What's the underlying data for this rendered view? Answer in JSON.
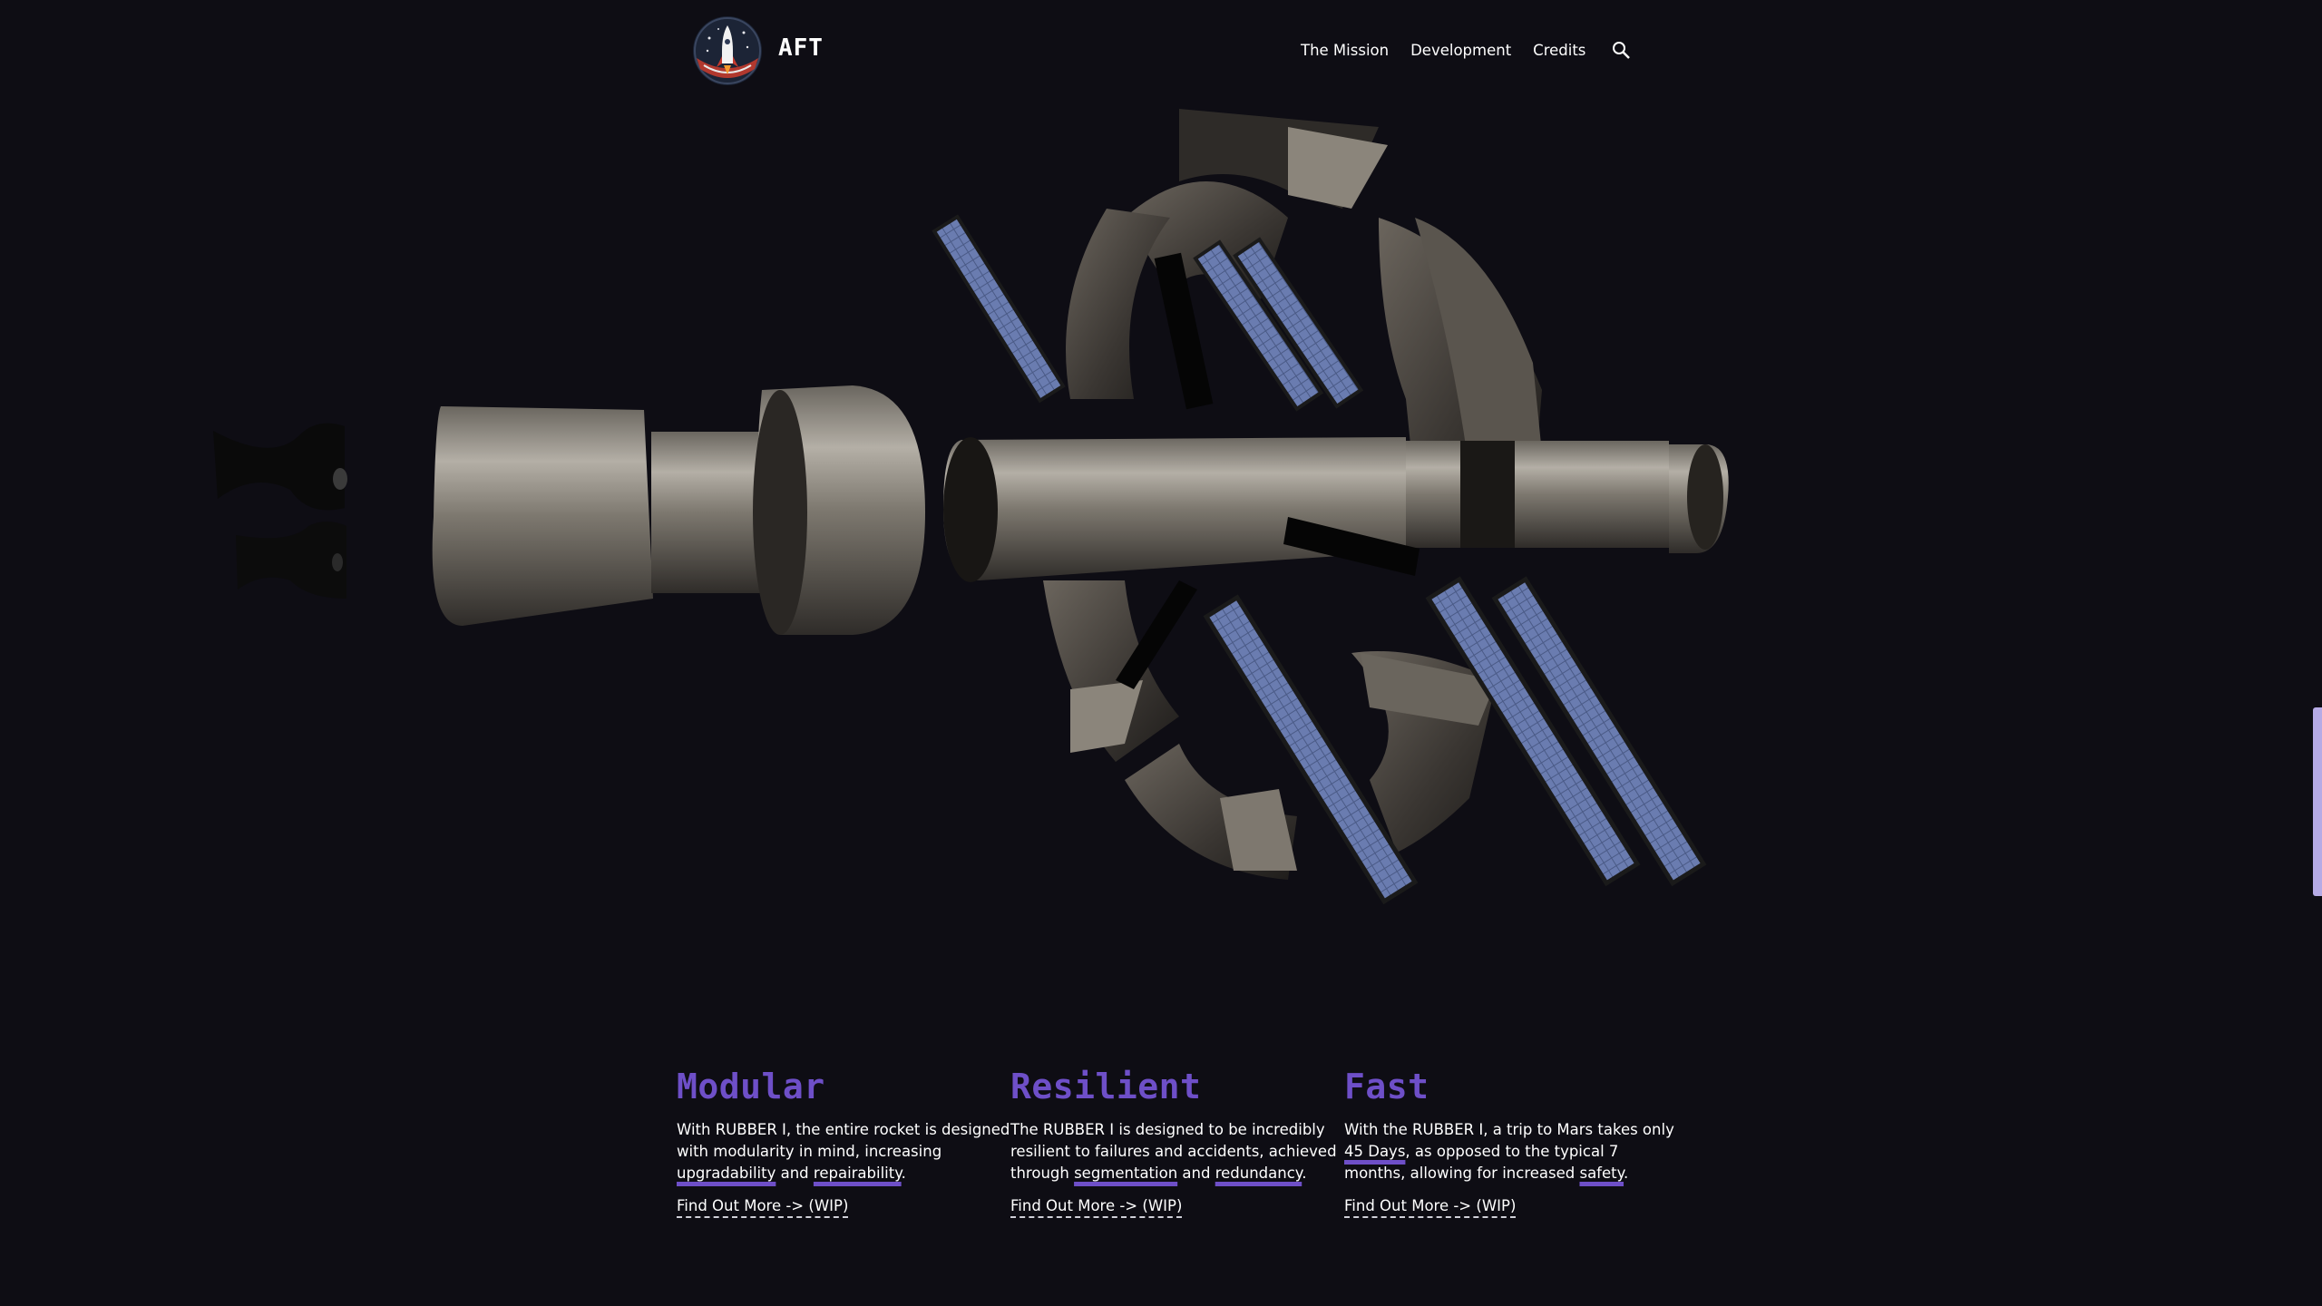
{
  "header": {
    "brand": "AFT",
    "nav": [
      {
        "label": "The Mission"
      },
      {
        "label": "Development"
      },
      {
        "label": "Credits"
      }
    ]
  },
  "icons": {
    "logo": "rocket-badge-icon",
    "search": "search-icon"
  },
  "features": [
    {
      "title": "Modular",
      "p1": "With RUBBER I, the entire rocket is designed with modularity in mind, increasing ",
      "h1": "upgradability",
      "p2": " and ",
      "h2": "repairability",
      "p3": ".",
      "link": "Find Out More -> (WIP)"
    },
    {
      "title": "Resilient",
      "p1": "The RUBBER I is designed to be incredibly resilient to failures and accidents, achieved through ",
      "h1": "segmentation",
      "p2": " and ",
      "h2": "redundancy",
      "p3": ".",
      "link": "Find Out More -> (WIP)"
    },
    {
      "title": "Fast",
      "p1": "With the RUBBER I, a trip to Mars takes only ",
      "h1": "45 Days",
      "p2": ", as opposed to the typical 7 months, allowing for increased ",
      "h2": "safety",
      "p3": ".",
      "link": "Find Out More -> (WIP)"
    }
  ],
  "colors": {
    "background": "#0e0d14",
    "accent": "#6e4fc8",
    "scrollbar": "#b6abe6"
  }
}
